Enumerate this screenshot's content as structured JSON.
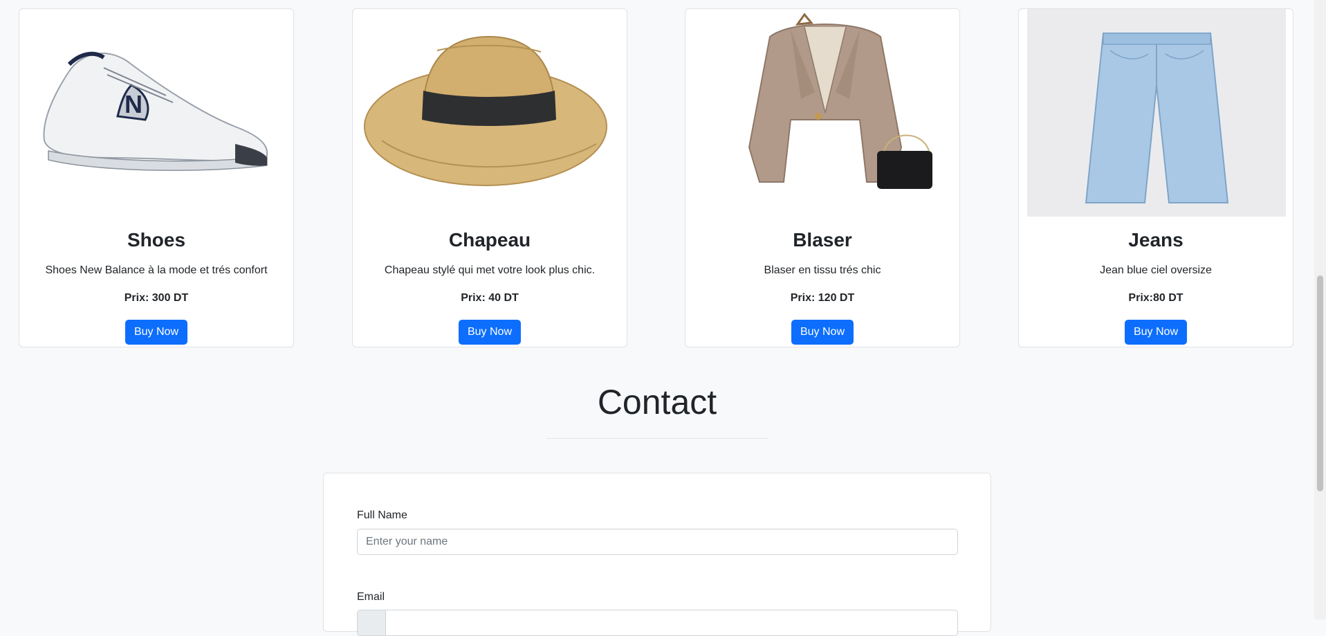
{
  "products": [
    {
      "name": "Shoes",
      "description": "Shoes New Balance à la mode et trés confort",
      "price": "Prix: 300 DT",
      "button": "Buy Now",
      "image": "sneaker"
    },
    {
      "name": "Chapeau",
      "description": "Chapeau stylé qui met votre look plus chic.",
      "price": "Prix: 40 DT",
      "button": "Buy Now",
      "image": "straw-hat"
    },
    {
      "name": "Blaser",
      "description": "Blaser en tissu trés chic",
      "price": "Prix: 120 DT",
      "button": "Buy Now",
      "image": "blazer"
    },
    {
      "name": "Jeans",
      "description": "Jean blue ciel oversize",
      "price": "Prix:80 DT",
      "button": "Buy Now",
      "image": "jeans"
    }
  ],
  "contact": {
    "title": "Contact",
    "full_name_label": "Full Name",
    "full_name_placeholder": "Enter your name",
    "email_label": "Email"
  },
  "colors": {
    "primary": "#0d6efd",
    "background": "#f8f9fa"
  }
}
